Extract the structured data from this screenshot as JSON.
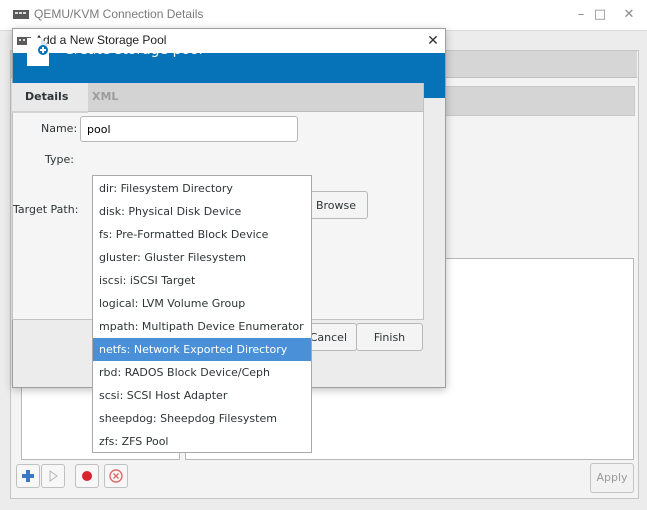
{
  "main_window": {
    "title": "QEMU/KVM Connection Details",
    "controls": {
      "minimize": "–",
      "maximize": "□",
      "close": "✕"
    },
    "storage_table_column_fragment": "y",
    "apply_label": "Apply"
  },
  "dialog": {
    "title": "Add a New Storage Pool",
    "close_glyph": "✕",
    "banner_title": "Create storage pool",
    "banner_color": "#0672b8",
    "tabs": [
      {
        "label": "Details",
        "active": true
      },
      {
        "label": "XML",
        "active": false
      }
    ],
    "fields": {
      "name_label": "Name:",
      "name_value": "pool",
      "type_label": "Type:",
      "target_label": "Target Path:"
    },
    "browse_label": "Browse",
    "cancel_label": "Cancel",
    "finish_label": "Finish"
  },
  "type_dropdown": {
    "selected_index": 7,
    "selected_color": "#4a90d9",
    "options": [
      "dir: Filesystem Directory",
      "disk: Physical Disk Device",
      "fs: Pre-Formatted Block Device",
      "gluster: Gluster Filesystem",
      "iscsi: iSCSI Target",
      "logical: LVM Volume Group",
      "mpath: Multipath Device Enumerator",
      "netfs: Network Exported Directory",
      "rbd: RADOS Block Device/Ceph",
      "scsi: SCSI Host Adapter",
      "sheepdog: Sheepdog Filesystem",
      "zfs: ZFS Pool"
    ]
  },
  "icons": {
    "window": "virt-manager-icon",
    "banner": "new-storage-pool-icon",
    "toolbar": [
      "add-pool-icon",
      "start-pool-icon",
      "stop-pool-icon",
      "delete-pool-icon"
    ]
  }
}
